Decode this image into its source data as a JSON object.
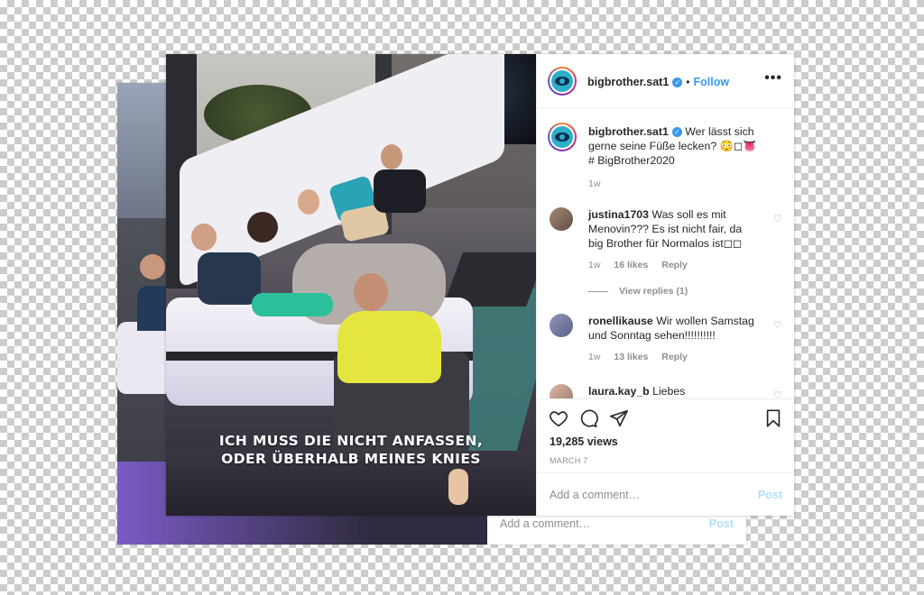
{
  "back_post": {
    "comment_placeholder": "Add a comment…",
    "post_label": "Post"
  },
  "video": {
    "caption_line1": "ICH MUSS DIE NICHT ANFASSEN,",
    "caption_line2": "ODER ÜBERHALB MEINES KNIES"
  },
  "header": {
    "username": "bigbrother.sat1",
    "verified_glyph": "✓",
    "dot": "•",
    "follow_label": "Follow",
    "more_glyph": "•••"
  },
  "caption_comment": {
    "username": "bigbrother.sat1",
    "text": "Wer lässt sich gerne seine Füße lecken? 😳◻👅 # BigBrother2020",
    "time": "1w"
  },
  "comments": [
    {
      "username": "justina1703",
      "text": "Was soll es mit Menovin??? Es ist nicht fair, da big Brother für Normalos ist◻◻",
      "time": "1w",
      "likes": "16 likes",
      "reply": "Reply",
      "view_replies": "View replies (1)"
    },
    {
      "username": "ronellikause",
      "text": "Wir wollen Samstag und Sonntag sehen!!!!!!!!!!",
      "time": "1w",
      "likes": "13 likes",
      "reply": "Reply"
    },
    {
      "username": "laura.kay_b",
      "text": "Liebes"
    }
  ],
  "icons": {
    "heart": "heart-icon",
    "comment": "comment-icon",
    "share": "share-icon",
    "save": "bookmark-icon"
  },
  "stats": {
    "views": "19,285 views",
    "date": "MARCH 7"
  },
  "add_comment": {
    "placeholder": "Add a comment…",
    "post_label": "Post"
  },
  "colors": {
    "link_blue": "#3897f0",
    "post_disabled": "#b2dffc",
    "meta_gray": "#8e8e8e"
  }
}
